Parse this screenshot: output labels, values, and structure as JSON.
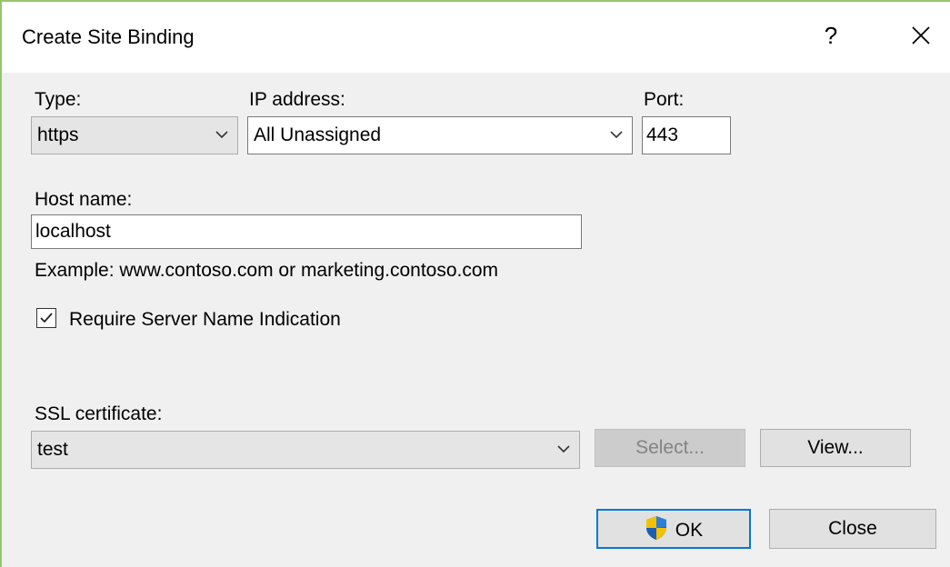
{
  "window": {
    "title": "Create Site Binding",
    "help_label": "?",
    "close_label": "✕"
  },
  "type": {
    "label": "Type:",
    "value": "https"
  },
  "ip": {
    "label": "IP address:",
    "value": "All Unassigned"
  },
  "port": {
    "label": "Port:",
    "value": "443"
  },
  "host": {
    "label": "Host name:",
    "value": "localhost",
    "example": "Example: www.contoso.com or marketing.contoso.com"
  },
  "sni": {
    "label": "Require Server Name Indication",
    "checked": true
  },
  "ssl": {
    "label": "SSL certificate:",
    "value": "test",
    "select_label": "Select...",
    "view_label": "View..."
  },
  "buttons": {
    "ok_label": "OK",
    "close_label": "Close"
  },
  "colors": {
    "accent": "#0078d7",
    "window_border": "#99c46c",
    "dialog_bg": "#f0f0f0"
  }
}
